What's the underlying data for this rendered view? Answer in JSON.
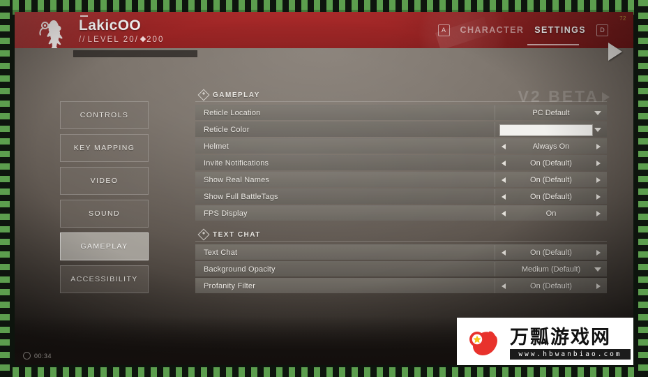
{
  "header": {
    "player_name": "LakicOO",
    "level_prefix": "//",
    "level_text": "LEVEL 20/",
    "currency_amount": "200",
    "coin_badge": "72",
    "nav": {
      "left_key": "A",
      "character_label": "CHARACTER",
      "settings_label": "SETTINGS",
      "right_key": "D"
    }
  },
  "sidebar": {
    "items": [
      {
        "label": "CONTROLS",
        "selected": false
      },
      {
        "label": "KEY MAPPING",
        "selected": false
      },
      {
        "label": "VIDEO",
        "selected": false
      },
      {
        "label": "SOUND",
        "selected": false
      },
      {
        "label": "GAMEPLAY",
        "selected": true
      },
      {
        "label": "ACCESSIBILITY",
        "selected": false
      }
    ]
  },
  "settings": {
    "sections": [
      {
        "title": "GAMEPLAY",
        "rows": [
          {
            "label": "Reticle Location",
            "value": "PC Default",
            "control": "dropdown"
          },
          {
            "label": "Reticle Color",
            "value": "",
            "control": "color",
            "color": "#f2f1ee"
          },
          {
            "label": "Helmet",
            "value": "Always On",
            "control": "stepper"
          },
          {
            "label": "Invite Notifications",
            "value": "On (Default)",
            "control": "stepper"
          },
          {
            "label": "Show Real Names",
            "value": "On (Default)",
            "control": "stepper"
          },
          {
            "label": "Show Full BattleTags",
            "value": "On (Default)",
            "control": "stepper"
          },
          {
            "label": "FPS Display",
            "value": "On",
            "control": "stepper"
          }
        ]
      },
      {
        "title": "TEXT CHAT",
        "rows": [
          {
            "label": "Text Chat",
            "value": "On (Default)",
            "control": "stepper"
          },
          {
            "label": "Background Opacity",
            "value": "Medium (Default)",
            "control": "dropdown"
          },
          {
            "label": "Profanity Filter",
            "value": "On (Default)",
            "control": "stepper"
          }
        ]
      }
    ]
  },
  "overlay": {
    "beta_watermark": "V2 BETA",
    "timer": "00:34"
  },
  "watermark_logo": {
    "chinese_text": "万瓢游戏网",
    "url": "www.hbwanbiao.com"
  },
  "colors": {
    "header_red": "#9c2525",
    "selected_item": "#c4c0ba",
    "row_grey": "#6a665f",
    "accent_text": "#ffffff"
  }
}
